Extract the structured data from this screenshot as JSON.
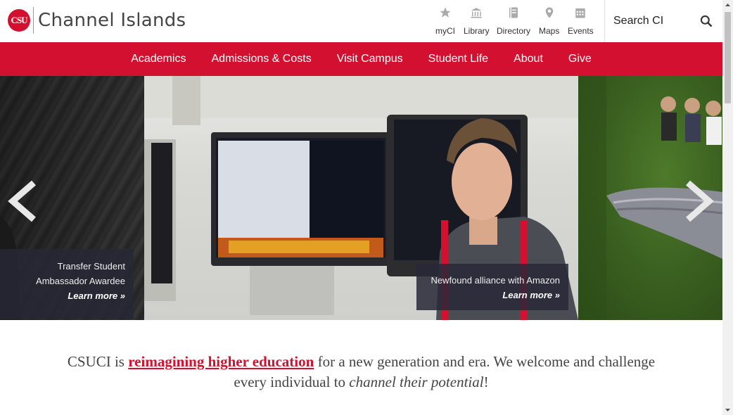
{
  "header": {
    "logo_text": "CSU",
    "site_name": "Channel Islands",
    "utility": [
      {
        "label": "myCI",
        "icon": "star-icon"
      },
      {
        "label": "Library",
        "icon": "library-icon"
      },
      {
        "label": "Directory",
        "icon": "directory-icon"
      },
      {
        "label": "Maps",
        "icon": "map-pin-icon"
      },
      {
        "label": "Events",
        "icon": "calendar-icon"
      }
    ],
    "search_placeholder": "Search CI"
  },
  "nav": {
    "items": [
      "Academics",
      "Admissions & Costs",
      "Visit Campus",
      "Student Life",
      "About",
      "Give"
    ]
  },
  "carousel": {
    "left_caption": {
      "text": "Transfer Student Ambassador Awardee",
      "link": "Learn more »"
    },
    "center_caption": {
      "text": "Newfound alliance with Amazon",
      "link": "Learn more »"
    }
  },
  "tagline": {
    "part1": "CSUCI is ",
    "highlight": "reimagining higher education",
    "part2": " for a new generation and era. We welcome and challenge every individual to ",
    "italic": "channel their potential",
    "part3": "!"
  },
  "colors": {
    "brand_red": "#d3102f"
  }
}
